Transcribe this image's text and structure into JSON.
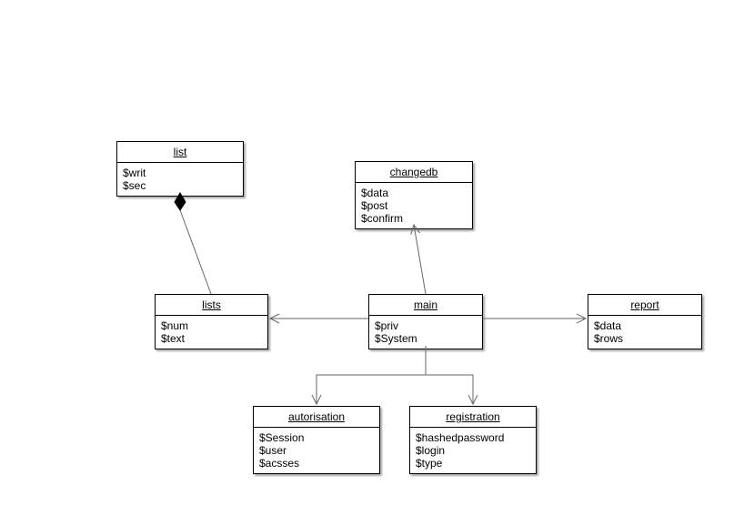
{
  "classes": {
    "list": {
      "name": "list",
      "attrs": [
        "$writ",
        "$sec"
      ]
    },
    "changedb": {
      "name": "changedb",
      "attrs": [
        "$data",
        "$post",
        "$confirm"
      ]
    },
    "lists": {
      "name": "lists",
      "attrs": [
        "$num",
        "$text"
      ]
    },
    "main": {
      "name": "main",
      "attrs": [
        "$priv",
        "$System"
      ]
    },
    "report": {
      "name": "report",
      "attrs": [
        "$data",
        "$rows"
      ]
    },
    "autorisation": {
      "name": "autorisation",
      "attrs": [
        "$Session",
        "$user",
        "$acsses"
      ]
    },
    "registration": {
      "name": "registration",
      "attrs": [
        "$hashedpassword",
        "$login",
        "$type"
      ]
    }
  },
  "relations": [
    {
      "from": "lists",
      "to": "list",
      "type": "composition"
    },
    {
      "from": "main",
      "to": "changedb",
      "type": "arrow"
    },
    {
      "from": "main",
      "to": "lists",
      "type": "arrow"
    },
    {
      "from": "main",
      "to": "report",
      "type": "arrow"
    },
    {
      "from": "main",
      "to": "autorisation",
      "type": "arrow"
    },
    {
      "from": "main",
      "to": "registration",
      "type": "arrow"
    }
  ]
}
